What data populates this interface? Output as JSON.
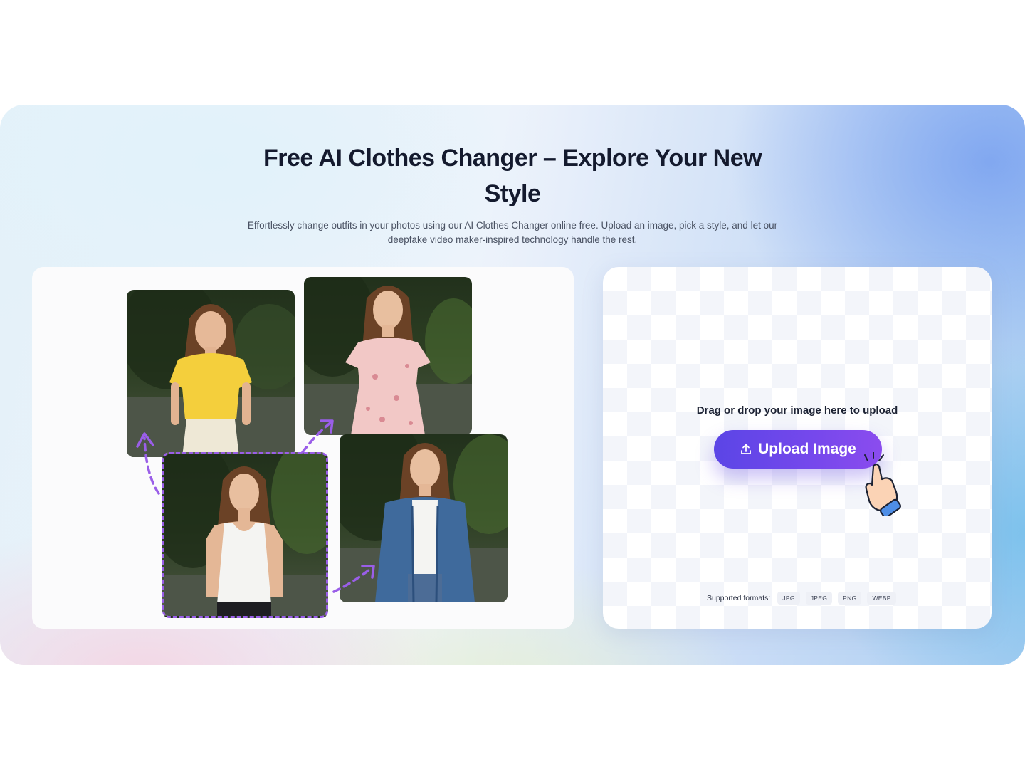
{
  "hero": {
    "title": "Free AI Clothes Changer – Explore Your New Style",
    "subtitle": "Effortlessly change outfits in your photos using our AI Clothes Changer online free. Upload an image, pick a style, and let our deepfake video maker-inspired technology handle the rest."
  },
  "gallery": {
    "photos": [
      {
        "outfit": "yellow t-shirt",
        "shirt_color": "#f4cf3c"
      },
      {
        "outfit": "pink floral dress",
        "shirt_color": "#f2c8c6"
      },
      {
        "outfit": "white tank top",
        "shirt_color": "#f4f4f2"
      },
      {
        "outfit": "denim jacket",
        "shirt_color": "#3f6a9c"
      }
    ],
    "accent_color": "#9a5ee8"
  },
  "upload": {
    "drop_text": "Drag or drop your image here to upload",
    "button_label": "Upload Image",
    "button_icon": "upload-icon",
    "formats_label": "Supported formats:",
    "formats": [
      "JPG",
      "JPEG",
      "PNG",
      "WEBP"
    ],
    "accent_color": "#6a47ea"
  }
}
